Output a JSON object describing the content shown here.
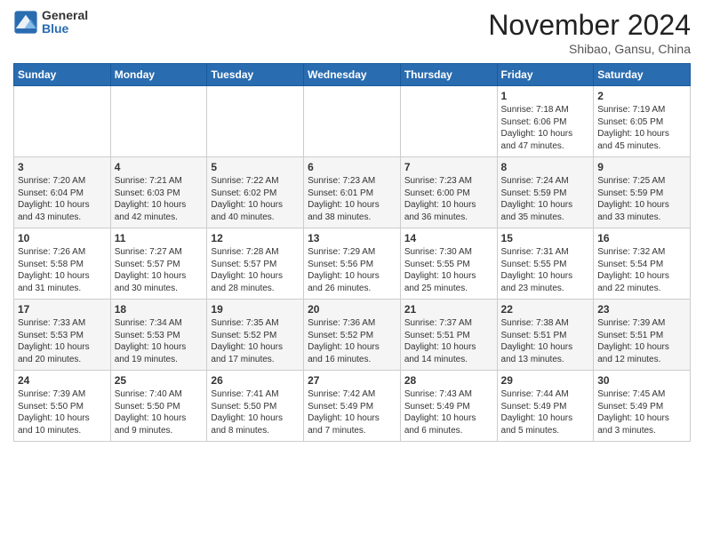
{
  "header": {
    "logo_general": "General",
    "logo_blue": "Blue",
    "month": "November 2024",
    "location": "Shibao, Gansu, China"
  },
  "days_of_week": [
    "Sunday",
    "Monday",
    "Tuesday",
    "Wednesday",
    "Thursday",
    "Friday",
    "Saturday"
  ],
  "weeks": [
    [
      {
        "day": "",
        "info": ""
      },
      {
        "day": "",
        "info": ""
      },
      {
        "day": "",
        "info": ""
      },
      {
        "day": "",
        "info": ""
      },
      {
        "day": "",
        "info": ""
      },
      {
        "day": "1",
        "info": "Sunrise: 7:18 AM\nSunset: 6:06 PM\nDaylight: 10 hours and 47 minutes."
      },
      {
        "day": "2",
        "info": "Sunrise: 7:19 AM\nSunset: 6:05 PM\nDaylight: 10 hours and 45 minutes."
      }
    ],
    [
      {
        "day": "3",
        "info": "Sunrise: 7:20 AM\nSunset: 6:04 PM\nDaylight: 10 hours and 43 minutes."
      },
      {
        "day": "4",
        "info": "Sunrise: 7:21 AM\nSunset: 6:03 PM\nDaylight: 10 hours and 42 minutes."
      },
      {
        "day": "5",
        "info": "Sunrise: 7:22 AM\nSunset: 6:02 PM\nDaylight: 10 hours and 40 minutes."
      },
      {
        "day": "6",
        "info": "Sunrise: 7:23 AM\nSunset: 6:01 PM\nDaylight: 10 hours and 38 minutes."
      },
      {
        "day": "7",
        "info": "Sunrise: 7:23 AM\nSunset: 6:00 PM\nDaylight: 10 hours and 36 minutes."
      },
      {
        "day": "8",
        "info": "Sunrise: 7:24 AM\nSunset: 5:59 PM\nDaylight: 10 hours and 35 minutes."
      },
      {
        "day": "9",
        "info": "Sunrise: 7:25 AM\nSunset: 5:59 PM\nDaylight: 10 hours and 33 minutes."
      }
    ],
    [
      {
        "day": "10",
        "info": "Sunrise: 7:26 AM\nSunset: 5:58 PM\nDaylight: 10 hours and 31 minutes."
      },
      {
        "day": "11",
        "info": "Sunrise: 7:27 AM\nSunset: 5:57 PM\nDaylight: 10 hours and 30 minutes."
      },
      {
        "day": "12",
        "info": "Sunrise: 7:28 AM\nSunset: 5:57 PM\nDaylight: 10 hours and 28 minutes."
      },
      {
        "day": "13",
        "info": "Sunrise: 7:29 AM\nSunset: 5:56 PM\nDaylight: 10 hours and 26 minutes."
      },
      {
        "day": "14",
        "info": "Sunrise: 7:30 AM\nSunset: 5:55 PM\nDaylight: 10 hours and 25 minutes."
      },
      {
        "day": "15",
        "info": "Sunrise: 7:31 AM\nSunset: 5:55 PM\nDaylight: 10 hours and 23 minutes."
      },
      {
        "day": "16",
        "info": "Sunrise: 7:32 AM\nSunset: 5:54 PM\nDaylight: 10 hours and 22 minutes."
      }
    ],
    [
      {
        "day": "17",
        "info": "Sunrise: 7:33 AM\nSunset: 5:53 PM\nDaylight: 10 hours and 20 minutes."
      },
      {
        "day": "18",
        "info": "Sunrise: 7:34 AM\nSunset: 5:53 PM\nDaylight: 10 hours and 19 minutes."
      },
      {
        "day": "19",
        "info": "Sunrise: 7:35 AM\nSunset: 5:52 PM\nDaylight: 10 hours and 17 minutes."
      },
      {
        "day": "20",
        "info": "Sunrise: 7:36 AM\nSunset: 5:52 PM\nDaylight: 10 hours and 16 minutes."
      },
      {
        "day": "21",
        "info": "Sunrise: 7:37 AM\nSunset: 5:51 PM\nDaylight: 10 hours and 14 minutes."
      },
      {
        "day": "22",
        "info": "Sunrise: 7:38 AM\nSunset: 5:51 PM\nDaylight: 10 hours and 13 minutes."
      },
      {
        "day": "23",
        "info": "Sunrise: 7:39 AM\nSunset: 5:51 PM\nDaylight: 10 hours and 12 minutes."
      }
    ],
    [
      {
        "day": "24",
        "info": "Sunrise: 7:39 AM\nSunset: 5:50 PM\nDaylight: 10 hours and 10 minutes."
      },
      {
        "day": "25",
        "info": "Sunrise: 7:40 AM\nSunset: 5:50 PM\nDaylight: 10 hours and 9 minutes."
      },
      {
        "day": "26",
        "info": "Sunrise: 7:41 AM\nSunset: 5:50 PM\nDaylight: 10 hours and 8 minutes."
      },
      {
        "day": "27",
        "info": "Sunrise: 7:42 AM\nSunset: 5:49 PM\nDaylight: 10 hours and 7 minutes."
      },
      {
        "day": "28",
        "info": "Sunrise: 7:43 AM\nSunset: 5:49 PM\nDaylight: 10 hours and 6 minutes."
      },
      {
        "day": "29",
        "info": "Sunrise: 7:44 AM\nSunset: 5:49 PM\nDaylight: 10 hours and 5 minutes."
      },
      {
        "day": "30",
        "info": "Sunrise: 7:45 AM\nSunset: 5:49 PM\nDaylight: 10 hours and 3 minutes."
      }
    ]
  ]
}
